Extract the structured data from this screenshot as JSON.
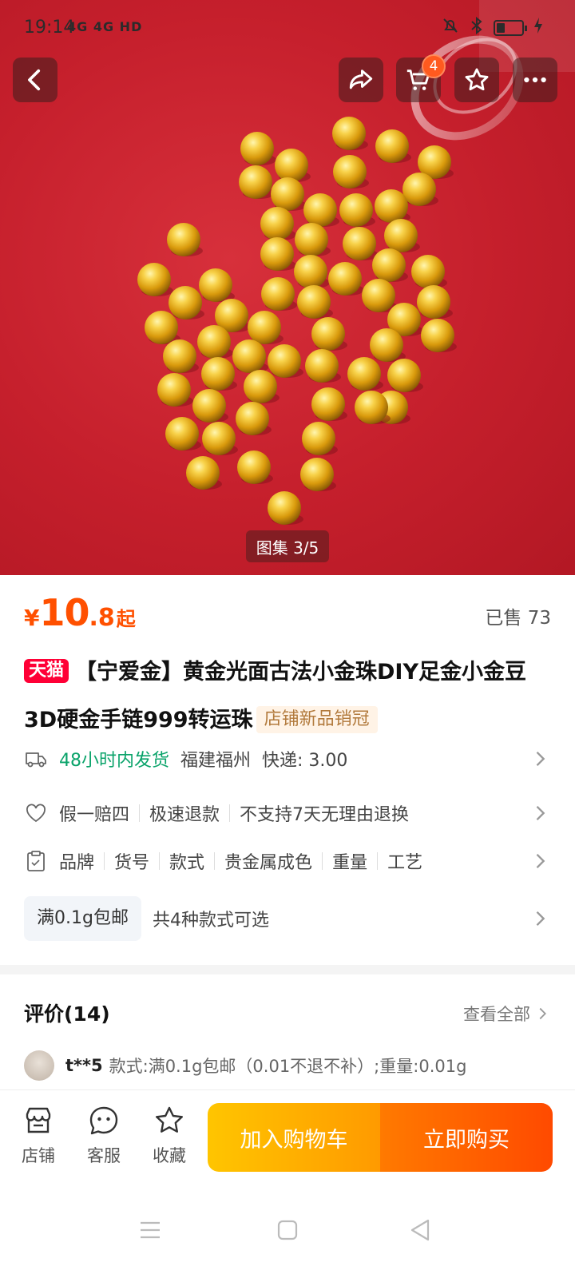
{
  "status_bar": {
    "time": "19:14",
    "network": "4G 4G HD"
  },
  "header": {
    "back_icon": "back-arrow-icon",
    "share_icon": "share-icon",
    "cart_icon": "cart-icon",
    "cart_count": "4",
    "favorite_icon": "star-icon",
    "more_icon": "more-dots-icon"
  },
  "gallery": {
    "counter": "图集 3/5"
  },
  "product": {
    "price_currency": "¥",
    "price_integer": "10",
    "price_decimal": ".8",
    "price_suffix": "起",
    "sold": "已售 73",
    "platform_badge": "天猫",
    "title": "【宁爱金】黄金光面古法小金珠DIY足金小金豆3D硬金手链999转运珠",
    "tag": "店铺新品销冠",
    "accent_color": "#ff5000"
  },
  "shipping": {
    "delivery": "48小时内发货",
    "origin": "福建福州",
    "fee": "快递: 3.00"
  },
  "guarantees": [
    "假一赔四",
    "极速退款",
    "不支持7天无理由退换"
  ],
  "params": [
    "品牌",
    "货号",
    "款式",
    "贵金属成色",
    "重量",
    "工艺"
  ],
  "spec": {
    "chip": "满0.1g包邮",
    "summary": "共4种款式可选"
  },
  "reviews": {
    "title": "评价(14)",
    "view_all": "查看全部",
    "first": {
      "user": "t**5",
      "text": "款式:满0.1g包邮（0.01不退不补）;重量:0.01g"
    }
  },
  "bottom_bar": {
    "store": "店铺",
    "service": "客服",
    "favorite": "收藏",
    "add_to_cart": "加入购物车",
    "buy_now": "立即购买"
  }
}
